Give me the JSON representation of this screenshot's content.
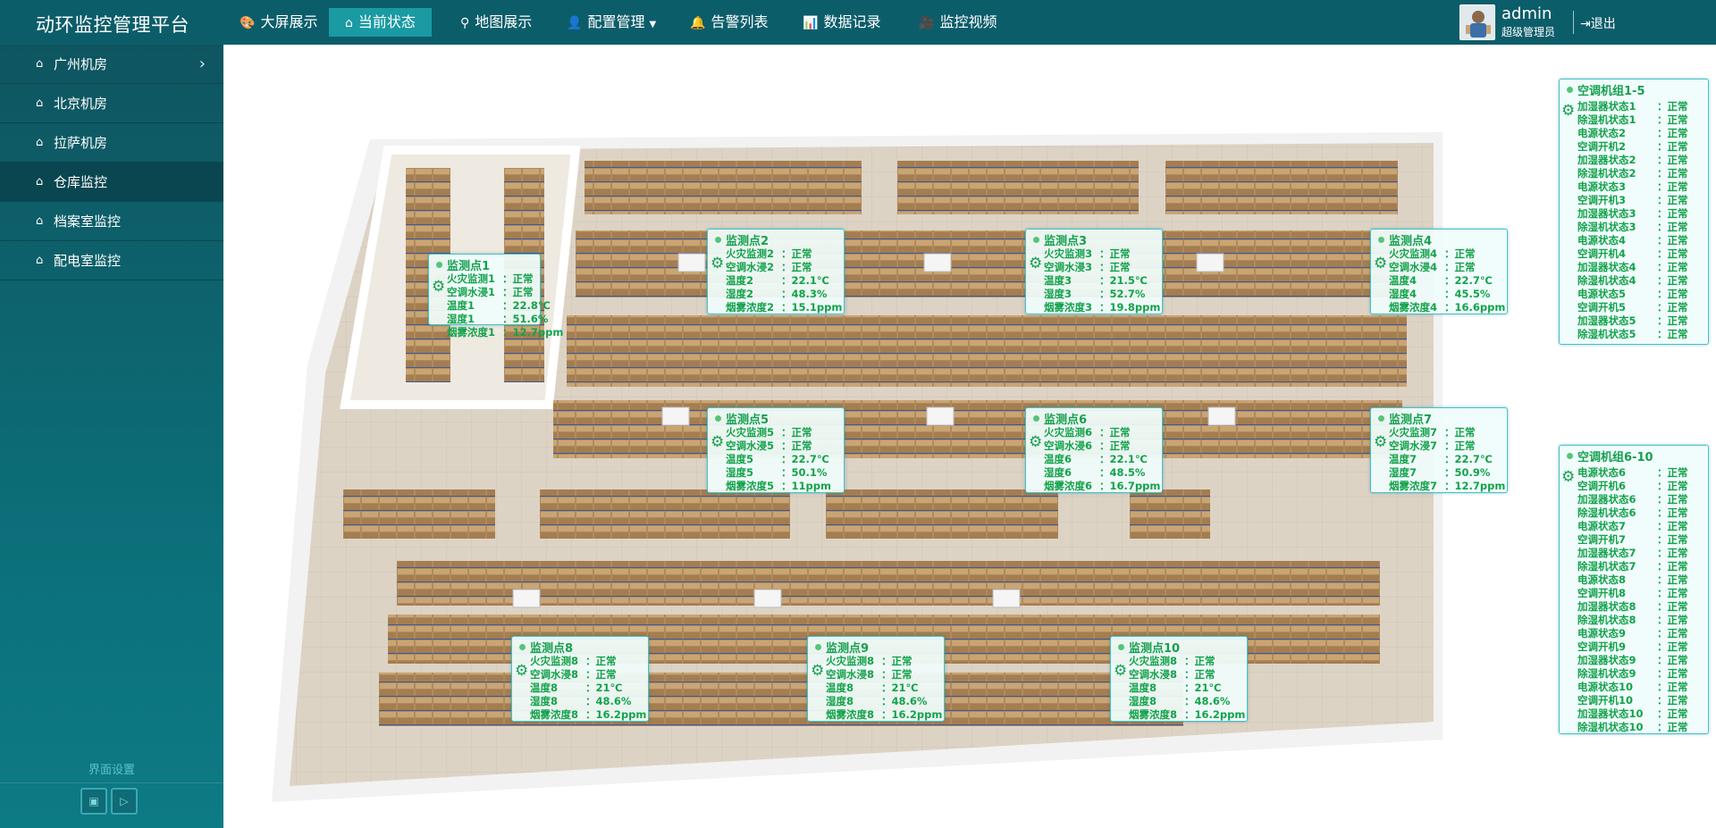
{
  "app": {
    "title": "动环监控管理平台"
  },
  "nav": [
    {
      "label": "大屏展示",
      "icon": "palette-icon"
    },
    {
      "label": "当前状态",
      "icon": "home-icon"
    },
    {
      "label": "地图展示",
      "icon": "map-pin-icon"
    },
    {
      "label": "配置管理",
      "icon": "user-config-icon"
    },
    {
      "label": "告警列表",
      "icon": "alarm-icon"
    },
    {
      "label": "数据记录",
      "icon": "chart-icon"
    },
    {
      "label": "监控视频",
      "icon": "camera-icon"
    }
  ],
  "user": {
    "name": "admin",
    "role": "超级管理员",
    "logout": "退出"
  },
  "sidebar": {
    "items": [
      {
        "label": "广州机房"
      },
      {
        "label": "北京机房"
      },
      {
        "label": "拉萨机房"
      },
      {
        "label": "仓库监控"
      },
      {
        "label": "档案室监控"
      },
      {
        "label": "配电室监控"
      }
    ],
    "settings": "界面设置"
  },
  "points": [
    {
      "title": "监测点1",
      "rows": [
        [
          "火灾监测1",
          "：正常"
        ],
        [
          "空调水浸1",
          "：正常"
        ],
        [
          "温度1",
          "：22.8℃"
        ],
        [
          "湿度1",
          "：51.6%"
        ],
        [
          "烟雾浓度1",
          "：12.7ppm"
        ]
      ]
    },
    {
      "title": "监测点2",
      "rows": [
        [
          "火灾监测2",
          "：正常"
        ],
        [
          "空调水浸2",
          "：正常"
        ],
        [
          "温度2",
          "：22.1℃"
        ],
        [
          "湿度2",
          "：48.3%"
        ],
        [
          "烟雾浓度2",
          "：15.1ppm"
        ]
      ]
    },
    {
      "title": "监测点3",
      "rows": [
        [
          "火灾监测3",
          "：正常"
        ],
        [
          "空调水浸3",
          "：正常"
        ],
        [
          "温度3",
          "：21.5℃"
        ],
        [
          "湿度3",
          "：52.7%"
        ],
        [
          "烟雾浓度3",
          "：19.8ppm"
        ]
      ]
    },
    {
      "title": "监测点4",
      "rows": [
        [
          "火灾监测4",
          "：正常"
        ],
        [
          "空调水浸4",
          "：正常"
        ],
        [
          "温度4",
          "：22.7℃"
        ],
        [
          "湿度4",
          "：45.5%"
        ],
        [
          "烟雾浓度4",
          "：16.6ppm"
        ]
      ]
    },
    {
      "title": "监测点5",
      "rows": [
        [
          "火灾监测5",
          "：正常"
        ],
        [
          "空调水浸5",
          "：正常"
        ],
        [
          "温度5",
          "：22.7℃"
        ],
        [
          "湿度5",
          "：50.1%"
        ],
        [
          "烟雾浓度5",
          "：11ppm"
        ]
      ]
    },
    {
      "title": "监测点6",
      "rows": [
        [
          "火灾监测6",
          "：正常"
        ],
        [
          "空调水浸6",
          "：正常"
        ],
        [
          "温度6",
          "：22.1℃"
        ],
        [
          "湿度6",
          "：48.5%"
        ],
        [
          "烟雾浓度6",
          "：16.7ppm"
        ]
      ]
    },
    {
      "title": "监测点7",
      "rows": [
        [
          "火灾监测7",
          "：正常"
        ],
        [
          "空调水浸7",
          "：正常"
        ],
        [
          "温度7",
          "：22.7℃"
        ],
        [
          "湿度7",
          "：50.9%"
        ],
        [
          "烟雾浓度7",
          "：12.7ppm"
        ]
      ]
    },
    {
      "title": "监测点8",
      "rows": [
        [
          "火灾监测8",
          "：正常"
        ],
        [
          "空调水浸8",
          "：正常"
        ],
        [
          "温度8",
          "：21℃"
        ],
        [
          "湿度8",
          "：48.6%"
        ],
        [
          "烟雾浓度8",
          "：16.2ppm"
        ]
      ]
    },
    {
      "title": "监测点9",
      "rows": [
        [
          "火灾监测8",
          "：正常"
        ],
        [
          "空调水浸8",
          "：正常"
        ],
        [
          "温度8",
          "：21℃"
        ],
        [
          "湿度8",
          "：48.6%"
        ],
        [
          "烟雾浓度8",
          "：16.2ppm"
        ]
      ]
    },
    {
      "title": "监测点10",
      "rows": [
        [
          "火灾监测8",
          "：正常"
        ],
        [
          "空调水浸8",
          "：正常"
        ],
        [
          "温度8",
          "：21℃"
        ],
        [
          "湿度8",
          "：48.6%"
        ],
        [
          "烟雾浓度8",
          "：16.2ppm"
        ]
      ]
    }
  ],
  "groups": [
    {
      "title": "空调机组1-5",
      "rows": [
        [
          "加湿器状态1",
          "：正常"
        ],
        [
          "除湿机状态1",
          "：正常"
        ],
        [
          "电源状态2",
          "：正常"
        ],
        [
          "空调开机2",
          "：正常"
        ],
        [
          "加湿器状态2",
          "：正常"
        ],
        [
          "除湿机状态2",
          "：正常"
        ],
        [
          "电源状态3",
          "：正常"
        ],
        [
          "空调开机3",
          "：正常"
        ],
        [
          "加湿器状态3",
          "：正常"
        ],
        [
          "除湿机状态3",
          "：正常"
        ],
        [
          "电源状态4",
          "：正常"
        ],
        [
          "空调开机4",
          "：正常"
        ],
        [
          "加湿器状态4",
          "：正常"
        ],
        [
          "除湿机状态4",
          "：正常"
        ],
        [
          "电源状态5",
          "：正常"
        ],
        [
          "空调开机5",
          "：正常"
        ],
        [
          "加湿器状态5",
          "：正常"
        ],
        [
          "除湿机状态5",
          "：正常"
        ]
      ]
    },
    {
      "title": "空调机组6-10",
      "rows": [
        [
          "电源状态6",
          "：正常"
        ],
        [
          "空调开机6",
          "：正常"
        ],
        [
          "加湿器状态6",
          "：正常"
        ],
        [
          "除湿机状态6",
          "：正常"
        ],
        [
          "电源状态7",
          "：正常"
        ],
        [
          "空调开机7",
          "：正常"
        ],
        [
          "加湿器状态7",
          "：正常"
        ],
        [
          "除湿机状态7",
          "：正常"
        ],
        [
          "电源状态8",
          "：正常"
        ],
        [
          "空调开机8",
          "：正常"
        ],
        [
          "加湿器状态8",
          "：正常"
        ],
        [
          "除湿机状态8",
          "：正常"
        ],
        [
          "电源状态9",
          "：正常"
        ],
        [
          "空调开机9",
          "：正常"
        ],
        [
          "加湿器状态9",
          "：正常"
        ],
        [
          "除湿机状态9",
          "：正常"
        ],
        [
          "电源状态10",
          "：正常"
        ],
        [
          "空调开机10",
          "：正常"
        ],
        [
          "加湿器状态10",
          "：正常"
        ],
        [
          "除湿机状态10",
          "：正常"
        ]
      ]
    }
  ],
  "colors": {
    "topbar": "#0c5d6a",
    "nav_active": "#1a9aa3",
    "panel_text": "#13a24b",
    "panel_border": "#43c2cc"
  }
}
